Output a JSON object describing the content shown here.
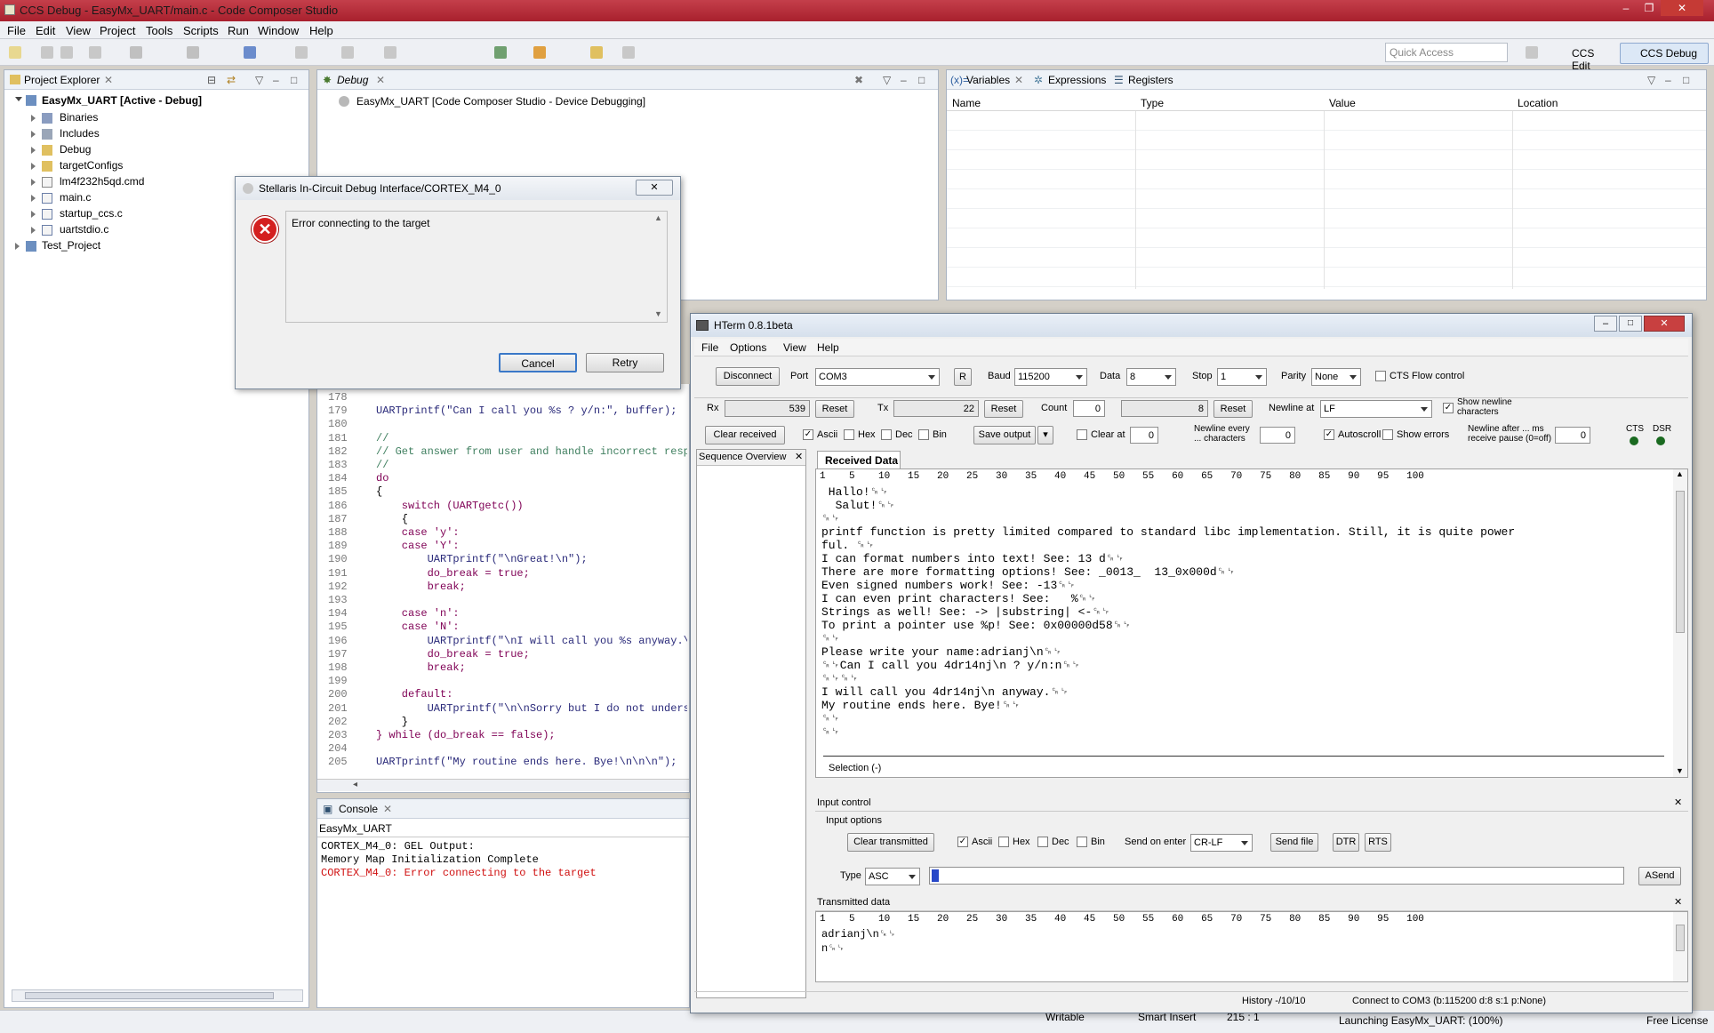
{
  "window": {
    "title": "CCS Debug - EasyMx_UART/main.c - Code Composer Studio"
  },
  "menu": [
    "File",
    "Edit",
    "View",
    "Project",
    "Tools",
    "Scripts",
    "Run",
    "Window",
    "Help"
  ],
  "toolbar": {
    "quick_access": "Quick Access",
    "persp_edit": "CCS Edit",
    "persp_debug": "CCS Debug"
  },
  "project_explorer": {
    "title": "Project Explorer",
    "root": "EasyMx_UART  [Active - Debug]",
    "items": [
      "Binaries",
      "Includes",
      "Debug",
      "targetConfigs",
      "lm4f232h5qd.cmd",
      "main.c",
      "startup_ccs.c",
      "uartstdio.c"
    ],
    "other_project": "Test_Project"
  },
  "debug": {
    "title": "Debug",
    "session": "EasyMx_UART [Code Composer Studio - Device Debugging]"
  },
  "variables": {
    "tabs": [
      "Variables",
      "Expressions",
      "Registers"
    ],
    "columns": [
      "Name",
      "Type",
      "Value",
      "Location"
    ]
  },
  "editor": {
    "lines": [
      {
        "n": "178",
        "t": ""
      },
      {
        "n": "179",
        "t": "UARTprintf(\"Can I call you %s ? y/n:\", buffer);"
      },
      {
        "n": "180",
        "t": ""
      },
      {
        "n": "181",
        "t": "//"
      },
      {
        "n": "182",
        "t": "// Get answer from user and handle incorrect respo"
      },
      {
        "n": "183",
        "t": "//"
      },
      {
        "n": "184",
        "t": "do"
      },
      {
        "n": "185",
        "t": "{"
      },
      {
        "n": "186",
        "t": "    switch (UARTgetc())"
      },
      {
        "n": "187",
        "t": "    {"
      },
      {
        "n": "188",
        "t": "    case 'y':"
      },
      {
        "n": "189",
        "t": "    case 'Y':"
      },
      {
        "n": "190",
        "t": "        UARTprintf(\"\\nGreat!\\n\");"
      },
      {
        "n": "191",
        "t": "        do_break = true;"
      },
      {
        "n": "192",
        "t": "        break;"
      },
      {
        "n": "193",
        "t": ""
      },
      {
        "n": "194",
        "t": "    case 'n':"
      },
      {
        "n": "195",
        "t": "    case 'N':"
      },
      {
        "n": "196",
        "t": "        UARTprintf(\"\\nI will call you %s anyway.\\n"
      },
      {
        "n": "197",
        "t": "        do_break = true;"
      },
      {
        "n": "198",
        "t": "        break;"
      },
      {
        "n": "199",
        "t": ""
      },
      {
        "n": "200",
        "t": "    default:"
      },
      {
        "n": "201",
        "t": "        UARTprintf(\"\\n\\nSorry but I do not underst"
      },
      {
        "n": "202",
        "t": "    }"
      },
      {
        "n": "203",
        "t": "} while (do_break == false);"
      },
      {
        "n": "204",
        "t": ""
      },
      {
        "n": "205",
        "t": "UARTprintf(\"My routine ends here. Bye!\\n\\n\\n\");"
      }
    ]
  },
  "console": {
    "title": "Console",
    "project": "EasyMx_UART",
    "lines": [
      "CORTEX_M4_0: GEL Output:",
      "Memory Map Initialization Complete"
    ],
    "error_line": "CORTEX_M4_0: Error connecting to the target"
  },
  "status": {
    "writable": "Writable",
    "insert": "Smart Insert",
    "pos": "215 : 1",
    "launching": "Launching EasyMx_UART: (100%)",
    "license": "Free License"
  },
  "dialog": {
    "title": "Stellaris In-Circuit Debug Interface/CORTEX_M4_0",
    "message": "Error connecting to the target",
    "cancel": "Cancel",
    "retry": "Retry"
  },
  "hterm": {
    "title": "HTerm 0.8.1beta",
    "menu": [
      "File",
      "Options",
      "View",
      "Help"
    ],
    "disconnect": "Disconnect",
    "port_label": "Port",
    "port": "COM3",
    "r_btn": "R",
    "baud_label": "Baud",
    "baud": "115200",
    "data_label": "Data",
    "data": "8",
    "stop_label": "Stop",
    "stop": "1",
    "parity_label": "Parity",
    "parity": "None",
    "cts_flow": "CTS Flow control",
    "rx_label": "Rx",
    "rx": "539",
    "tx_label": "Tx",
    "tx": "22",
    "reset": "Reset",
    "count_label": "Count",
    "count": "0",
    "count2": "8",
    "newline_at_label": "Newline at",
    "newline_at": "LF",
    "show_newline": "Show newline characters",
    "clear_received": "Clear received",
    "ascii": "Ascii",
    "hex": "Hex",
    "dec": "Dec",
    "bin": "Bin",
    "save_output": "Save output",
    "clear_at": "Clear at",
    "clear_at_val": "0",
    "newline_every": "Newline every ... characters",
    "newline_every_val": "0",
    "autoscroll": "Autoscroll",
    "show_errors": "Show errors",
    "newline_after": "Newline after ... ms receive pause (0=off)",
    "newline_after_val": "0",
    "cts": "CTS",
    "dsr": "DSR",
    "sequence_overview": "Sequence Overview",
    "received_tab": "Received Data",
    "ruler": "1    5    10   15   20   25   30   35   40   45   50   55   60   65   70   75   80   85   90   95   100",
    "received_lines": [
      " Hallo!␍␊",
      "  Salut!␍␊",
      "␍␊",
      "printf function is pretty limited compared to standard libc implementation. Still, it is quite power",
      "ful. ␍␊",
      "I can format numbers into text! See: 13 d␍␊",
      "There are more formatting options! See: _0013_  13_0x000d␍␊",
      "Even signed numbers work! See: -13␍␊",
      "I can even print characters! See:   %␍␊",
      "Strings as well! See: -> |substring| <-␍␊",
      "To print a pointer use %p! See: 0x00000d58␍␊",
      "␍␊",
      "Please write your name:adrianj\\n␍␊",
      "␍␊Can I call you 4dr14nj\\n ? y/n:n␍␊",
      "␍␊␍␊",
      "I will call you 4dr14nj\\n anyway.␍␊",
      "My routine ends here. Bye!␍␊",
      "␍␊",
      "␍␊"
    ],
    "selection": "Selection (-)",
    "input_control": "Input control",
    "input_options": "Input options",
    "clear_transmitted": "Clear transmitted",
    "send_on_enter_label": "Send on enter",
    "send_on_enter": "CR-LF",
    "send_file": "Send file",
    "dtr": "DTR",
    "rts": "RTS",
    "type_label": "Type",
    "type": "ASC",
    "asend": "ASend",
    "transmitted_title": "Transmitted data",
    "tx_lines": [
      "adrianj\\n␍␊",
      "n␍␊"
    ],
    "history": "History -/10/10",
    "connect_status": "Connect to COM3 (b:115200 d:8 s:1 p:None)"
  }
}
